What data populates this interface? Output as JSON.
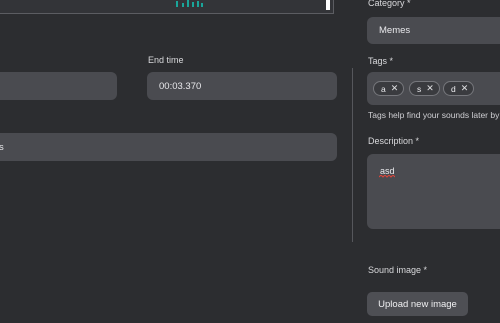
{
  "labels": {
    "category": "Category *",
    "end_time": "End time",
    "tags": "Tags *",
    "description": "Description *",
    "sound_image": "Sound image *"
  },
  "category": {
    "value": "Memes"
  },
  "start_time": {
    "value": ""
  },
  "end_time": {
    "value": "00:03.370"
  },
  "name": {
    "value_tail": "s"
  },
  "tags": [
    {
      "label": "a"
    },
    {
      "label": "s"
    },
    {
      "label": "d"
    }
  ],
  "tags_hint": "Tags help find your sounds later by",
  "description": {
    "value": "asd"
  },
  "upload_button": "Upload new image",
  "colors": {
    "background": "#2c2d30",
    "field": "#4a4b50",
    "accent_wave": "#1aa59a",
    "spellcheck": "#e0453a"
  },
  "icons": {
    "tag_remove": "close-icon"
  }
}
